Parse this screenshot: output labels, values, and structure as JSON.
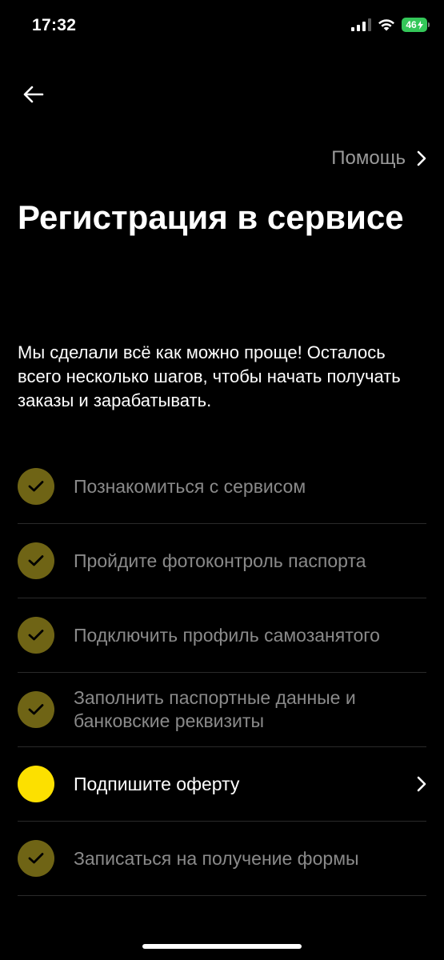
{
  "status_bar": {
    "time": "17:32",
    "battery": "46"
  },
  "header": {
    "back_icon": "arrow-left-icon",
    "help_label": "Помощь"
  },
  "title": "Регистрация в сервисе",
  "intro": "Мы сделали всё как можно проще! Осталось всего несколько шагов, чтобы начать получать заказы и зарабатывать.",
  "steps": [
    {
      "label": "Познакомиться с сервисом",
      "status": "done"
    },
    {
      "label": "Пройдите фотоконтроль паспорта",
      "status": "done"
    },
    {
      "label": "Подключить профиль самозанятого",
      "status": "done"
    },
    {
      "label": "Заполнить паспортные данные и банковские реквизиты",
      "status": "done"
    },
    {
      "label": "Подпишите оферту",
      "status": "current"
    },
    {
      "label": "Записаться на получение формы",
      "status": "done"
    }
  ],
  "colors": {
    "background": "#000000",
    "accent": "#fce000",
    "done_check": "#6f6415",
    "muted_text": "#8a8a8a",
    "battery": "#34c759"
  }
}
